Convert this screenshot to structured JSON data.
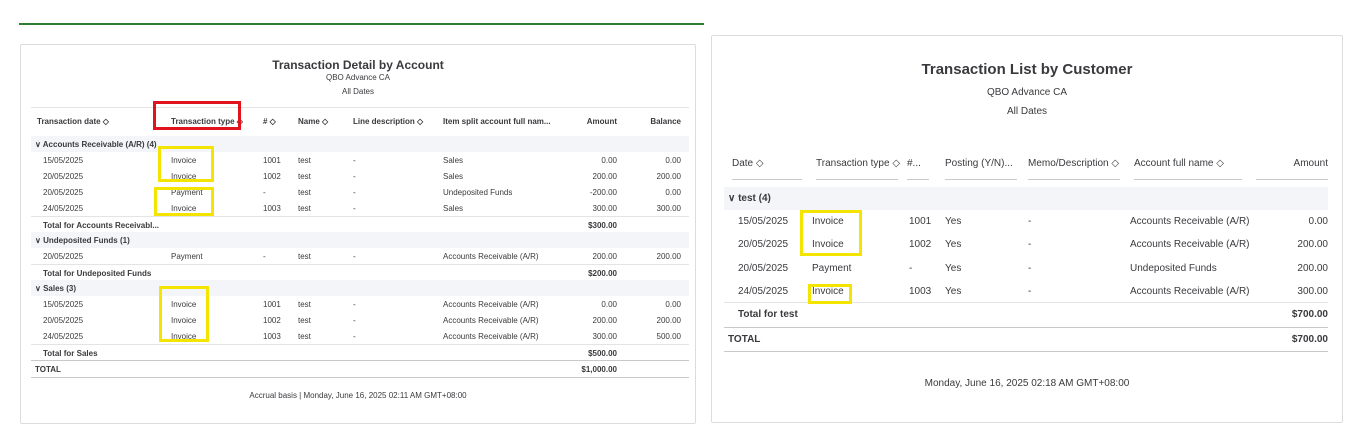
{
  "left_report": {
    "title": "Transaction Detail by Account",
    "company": "QBO Advance CA",
    "period": "All Dates",
    "columns": [
      "Transaction date ◇",
      "Transaction type ◇",
      "# ◇",
      "Name ◇",
      "Line description ◇",
      "Item split account full nam...",
      "Amount",
      "Balance"
    ],
    "groups": [
      {
        "label": "∨  Accounts Receivable (A/R) (4)",
        "rows": [
          [
            "15/05/2025",
            "Invoice",
            "1001",
            "test",
            "-",
            "Sales",
            "0.00",
            "0.00"
          ],
          [
            "20/05/2025",
            "Invoice",
            "1002",
            "test",
            "-",
            "Sales",
            "200.00",
            "200.00"
          ],
          [
            "20/05/2025",
            "Payment",
            "-",
            "test",
            "-",
            "Undeposited Funds",
            "-200.00",
            "0.00"
          ],
          [
            "24/05/2025",
            "Invoice",
            "1003",
            "test",
            "-",
            "Sales",
            "300.00",
            "300.00"
          ]
        ],
        "total_label": "Total for Accounts Receivabl...",
        "total": "$300.00"
      },
      {
        "label": "∨  Undeposited Funds (1)",
        "rows": [
          [
            "20/05/2025",
            "Payment",
            "-",
            "test",
            "-",
            "Accounts Receivable (A/R)",
            "200.00",
            "200.00"
          ]
        ],
        "total_label": "Total for Undeposited Funds",
        "total": "$200.00"
      },
      {
        "label": "∨  Sales (3)",
        "rows": [
          [
            "15/05/2025",
            "Invoice",
            "1001",
            "test",
            "-",
            "Accounts Receivable (A/R)",
            "0.00",
            "0.00"
          ],
          [
            "20/05/2025",
            "Invoice",
            "1002",
            "test",
            "-",
            "Accounts Receivable (A/R)",
            "200.00",
            "200.00"
          ],
          [
            "24/05/2025",
            "Invoice",
            "1003",
            "test",
            "-",
            "Accounts Receivable (A/R)",
            "300.00",
            "500.00"
          ]
        ],
        "total_label": "Total for Sales",
        "total": "$500.00"
      }
    ],
    "grand_total_label": "TOTAL",
    "grand_total": "$1,000.00",
    "footer": "Accrual basis  |  Monday, June 16, 2025 02:11 AM GMT+08:00"
  },
  "right_report": {
    "title": "Transaction List by Customer",
    "company": "QBO Advance CA",
    "period": "All Dates",
    "columns": [
      "Date ◇",
      "Transaction type ◇",
      "#...",
      "Posting (Y/N)...",
      "Memo/Description ◇",
      "Account full name ◇",
      "Amount"
    ],
    "group_label": "∨  test (4)",
    "rows": [
      [
        "15/05/2025",
        "Invoice",
        "1001",
        "Yes",
        "-",
        "Accounts Receivable (A/R)",
        "0.00"
      ],
      [
        "20/05/2025",
        "Invoice",
        "1002",
        "Yes",
        "-",
        "Accounts Receivable (A/R)",
        "200.00"
      ],
      [
        "20/05/2025",
        "Payment",
        "-",
        "Yes",
        "-",
        "Undeposited Funds",
        "200.00"
      ],
      [
        "24/05/2025",
        "Invoice",
        "1003",
        "Yes",
        "-",
        "Accounts Receivable (A/R)",
        "300.00"
      ]
    ],
    "total_label": "Total for test",
    "total": "$700.00",
    "grand_total_label": "TOTAL",
    "grand_total": "$700.00",
    "footer": "Monday, June 16, 2025 02:18 AM GMT+08:00"
  },
  "colors": {
    "highlight_yellow": "#f3e500",
    "highlight_red": "#e0141e",
    "accent_green": "#2e7d32"
  }
}
